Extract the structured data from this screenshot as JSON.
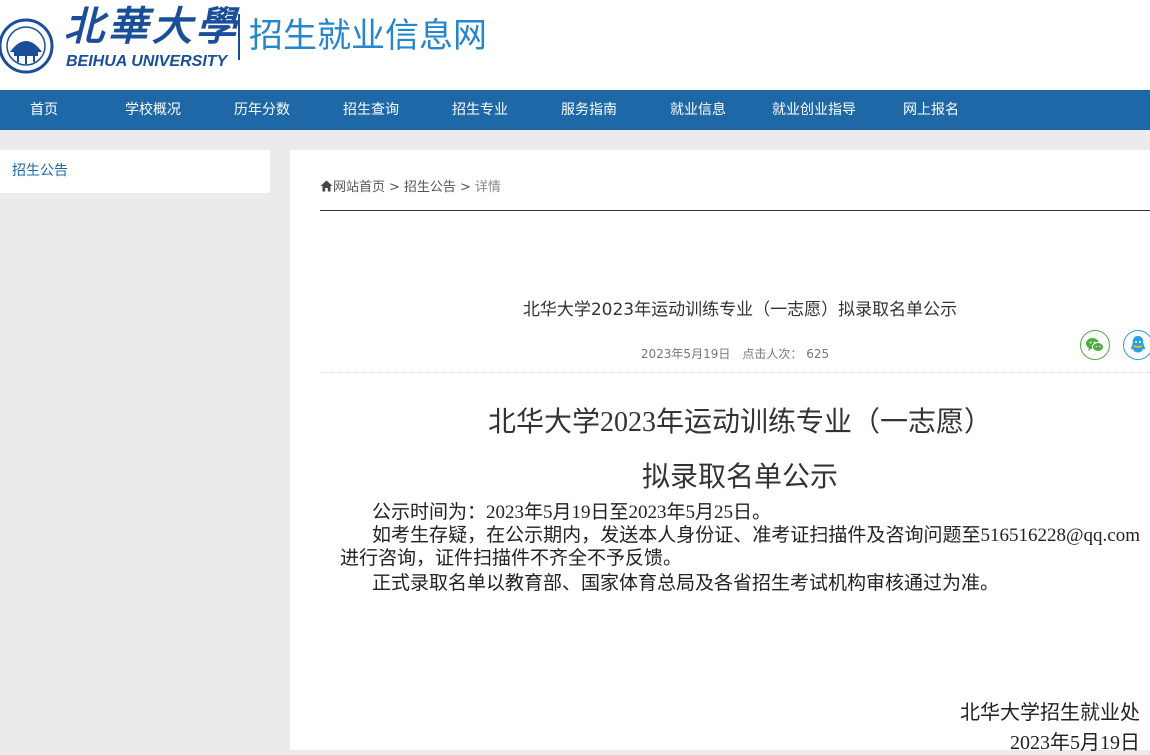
{
  "header": {
    "logo_cn": "北華大學",
    "logo_en": "BEIHUA UNIVERSITY",
    "site_title": "招生就业信息网"
  },
  "nav": {
    "items": [
      "首页",
      "学校概况",
      "历年分数",
      "招生查询",
      "招生专业",
      "服务指南",
      "就业信息",
      "就业创业指导",
      "网上报名"
    ]
  },
  "sidebar": {
    "items": [
      {
        "label": "招生公告"
      }
    ]
  },
  "breadcrumb": {
    "home": "网站首页",
    "sep": ">",
    "section": "招生公告",
    "current": "详情"
  },
  "article": {
    "title": "北华大学2023年运动训练专业（一志愿）拟录取名单公示",
    "date": "2023年5月19日",
    "views_label": "点击人次：",
    "views": "625",
    "heading_line1": "北华大学2023年运动训练专业（一志愿）",
    "heading_line2": "拟录取名单公示",
    "para1": "公示时间为：2023年5月19日至2023年5月25日。",
    "para2": "如考生存疑，在公示期内，发送本人身份证、准考证扫描件及咨询问题至516516228@qq.com进行咨询，证件扫描件不齐全不予反馈。",
    "para3": "正式录取名单以教育部、国家体育总局及各省招生考试机构审核通过为准。",
    "signature_org": "北华大学招生就业处",
    "signature_date": "2023年5月19日"
  },
  "colors": {
    "nav_bg": "#1e68a8",
    "brand_blue": "#1a4e98",
    "title_blue": "#2686cc",
    "wechat_green": "#4caf3c",
    "qq_blue": "#2aa0e0"
  },
  "icons": {
    "home": "home-icon",
    "wechat": "wechat-icon",
    "qq": "qq-icon"
  }
}
